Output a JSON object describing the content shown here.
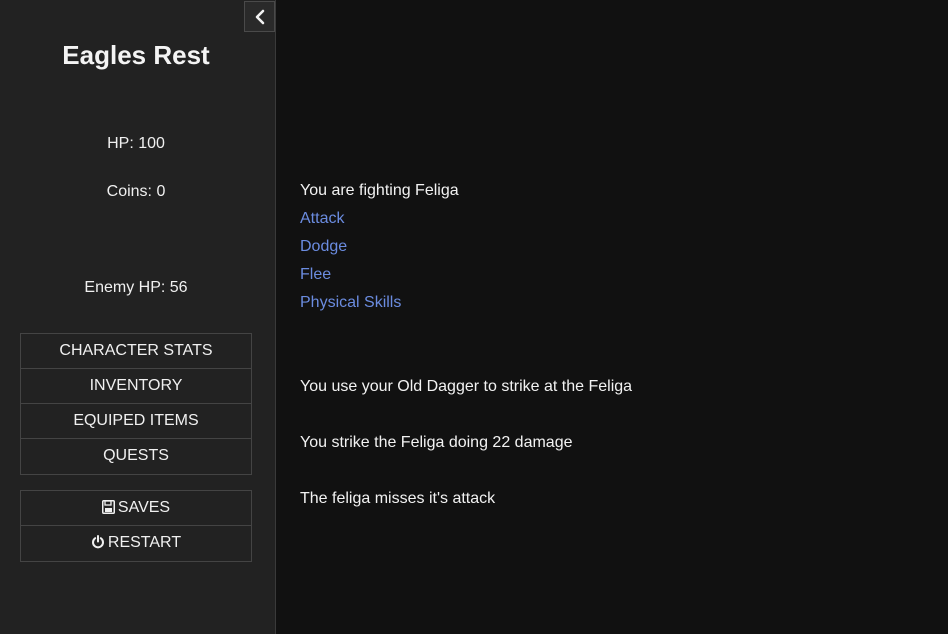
{
  "sidebar": {
    "title": "Eagles Rest",
    "hp": "HP: 100",
    "coins": "Coins: 0",
    "enemy_hp": "Enemy HP: 56",
    "menu": [
      "CHARACTER STATS",
      "INVENTORY",
      "EQUIPED ITEMS",
      "QUESTS"
    ],
    "saves_label": "SAVES",
    "restart_label": "RESTART"
  },
  "passage": {
    "intro": "You are fighting Feliga",
    "choices": [
      "Attack",
      "Dodge",
      "Flee",
      "Physical Skills"
    ],
    "log": [
      "You use your Old Dagger to strike at the Feliga",
      "You strike the Feliga doing 22 damage",
      "The feliga misses it's attack"
    ]
  },
  "colors": {
    "background": "#111111",
    "sidebar": "#222222",
    "link": "#6b8ce0",
    "text": "#f2f2f2"
  }
}
